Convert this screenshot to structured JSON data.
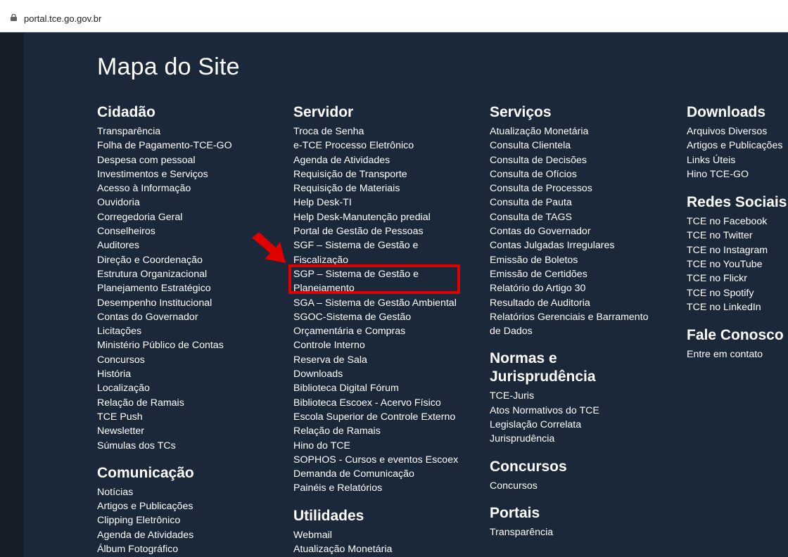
{
  "browser": {
    "url": "portal.tce.go.gov.br",
    "lock_icon": "lock-icon"
  },
  "page": {
    "title": "Mapa do Site"
  },
  "columns": [
    {
      "sections": [
        {
          "heading": "Cidadão",
          "links": [
            "Transparência",
            "Folha de Pagamento-TCE-GO",
            "Despesa com pessoal",
            "Investimentos e Serviços",
            "Acesso à Informação",
            "Ouvidoria",
            "Corregedoria Geral",
            "Conselheiros",
            "Auditores",
            "Direção e Coordenação",
            "Estrutura Organizacional",
            "Planejamento Estratégico",
            "Desempenho Institucional",
            "Contas do Governador",
            "Licitações",
            "Ministério Público de Contas",
            "Concursos",
            "História",
            "Localização",
            "Relação de Ramais",
            "TCE Push",
            "Newsletter",
            "Súmulas dos TCs"
          ]
        },
        {
          "heading": "Comunicação",
          "links": [
            "Notícias",
            "Artigos e Publicações",
            "Clipping Eletrônico",
            "Agenda de Atividades",
            "Álbum Fotográfico"
          ]
        }
      ]
    },
    {
      "sections": [
        {
          "heading": "Servidor",
          "links": [
            "Troca de Senha",
            "e-TCE Processo Eletrônico",
            "Agenda de Atividades",
            "Requisição de Transporte",
            "Requisição de Materiais",
            "Help Desk-TI",
            "Help Desk-Manutenção predial",
            "Portal de Gestão de Pessoas",
            "SGF – Sistema de Gestão e",
            "Fiscalização",
            "SGP – Sistema de Gestão e",
            "Planejamento",
            "SGA – Sistema de Gestão Ambiental",
            "SGOC-Sistema de Gestão",
            "Orçamentária e Compras",
            "Controle Interno",
            "Reserva de Sala",
            "Downloads",
            "Biblioteca Digital Fórum",
            "Biblioteca Escoex - Acervo Físico",
            "Escola Superior de Controle Externo",
            "Relação de Ramais",
            "Hino do TCE",
            "SOPHOS - Cursos e eventos Escoex",
            "Demanda de Comunicação",
            "Painéis e Relatórios"
          ]
        },
        {
          "heading": "Utilidades",
          "links": [
            "Webmail",
            "Atualização Monetária"
          ]
        }
      ]
    },
    {
      "sections": [
        {
          "heading": "Serviços",
          "links": [
            "Atualização Monetária",
            "Consulta Clientela",
            "Consulta de Decisões",
            "Consulta de Ofícios",
            "Consulta de Processos",
            "Consulta de Pauta",
            "Consulta de TAGS",
            "Contas do Governador",
            "Contas Julgadas Irregulares",
            "Emissão de Boletos",
            "Emissão de Certidões",
            "Relatório do Artigo 30",
            "Resultado de Auditoria",
            "Relatórios Gerenciais e Barramento",
            "de Dados"
          ]
        },
        {
          "heading_lines": [
            "Normas e",
            "Jurisprudência"
          ],
          "links": [
            "TCE-Juris",
            "Atos Normativos do TCE",
            "Legislação Correlata",
            "Jurisprudência"
          ]
        },
        {
          "heading": "Concursos",
          "links": [
            "Concursos"
          ]
        },
        {
          "heading": "Portais",
          "links": [
            "Transparência"
          ]
        }
      ]
    },
    {
      "sections": [
        {
          "heading": "Downloads",
          "links": [
            "Arquivos Diversos",
            "Artigos e Publicações",
            "Links Úteis",
            "Hino TCE-GO"
          ]
        },
        {
          "heading": "Redes Sociais",
          "links": [
            "TCE no Facebook",
            "TCE no Twitter",
            "TCE no Instagram",
            "TCE no YouTube",
            "TCE no Flickr",
            "TCE no Spotify",
            "TCE no LinkedIn"
          ]
        },
        {
          "heading": "Fale Conosco",
          "links": [
            "Entre em contato"
          ]
        }
      ]
    }
  ],
  "annotation": {
    "arrow_icon": "arrow-pointer-icon",
    "highlight_color": "#e10000"
  },
  "colors": {
    "background": "#1b2839",
    "text": "#ffffff"
  }
}
